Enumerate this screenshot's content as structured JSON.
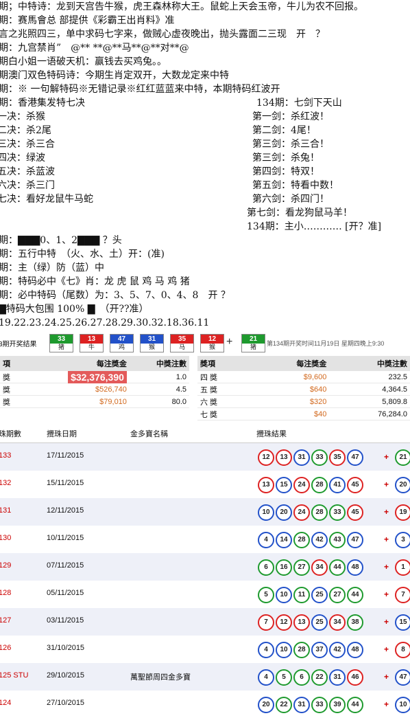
{
  "lines": [
    {
      "text": "期；中特诗：龙到天宫告牛猴，虎王森林称大王。鼠蛇上天会玉帝，牛儿为农不回报。"
    },
    {
      "text": "期：赛馬會总 部提供《彩霸王出肖料》准"
    },
    {
      "text": "言之兆照四三，单中求码七字来，做贼心虚夜晚出，抛头露面二三现　开　？"
    },
    {
      "text": "期：九宫禁肖”　@** **@**马**@**对**@"
    },
    {
      "text": "期白小姐一语破天机：赢钱去买鸡兔。。"
    },
    {
      "text": "期澳门双色特码诗：今期生肖定双开，大数龙定来中特"
    },
    {
      "text": "期：※ 一句解特码※无错记录※红红蓝蓝来中特，本期特码红波开"
    },
    {
      "text": "期：香港集发特七决"
    }
  ],
  "left_list": [
    "一决：杀猴",
    "二决：杀2尾",
    "三决：杀三合",
    "四决：绿波",
    "五决：杀蓝波",
    "六决：杀三门",
    "七决：看好龙鼠牛马蛇"
  ],
  "right_list": [
    "134期：七剑下天山",
    "第一剑：杀红波！",
    "第二剑：4尾！",
    "第三剑：杀三合！",
    "第三剑：杀兔！",
    "第四剑：特双！",
    "第五剑：特看中数！",
    "第六剑：杀四门！",
    "第七剑：看龙狗鼠马羊！",
    "134期：主小………… [开？准]"
  ],
  "lines2": [
    {
      "text": "期：▇▇▇0、1、2▇▇▇ ？头"
    },
    {
      "text": "期：五行中特　（火、水、土）开：(准)"
    },
    {
      "text": "期：主（绿）防（蓝）中"
    },
    {
      "text": "期：特码必中《七》肖：龙 虎 鼠 鸡 马 鸡 猪"
    },
    {
      "text": "期：必中特码（尾数）为：3、5、7、0、4、8　开 ？"
    },
    {
      "text": "▇特码大包围 100% ▇　（开??准）"
    },
    {
      "text": "19.22.23.24.25.26.27.28.29.30.32.18.36.11"
    }
  ],
  "strip": {
    "label": "3期开奖结果",
    "chips": [
      {
        "n": "33",
        "z": "猪",
        "color": "#1e9a2e"
      },
      {
        "n": "13",
        "z": "牛",
        "color": "#d22"
      },
      {
        "n": "47",
        "z": "鸡",
        "color": "#2251c9"
      },
      {
        "n": "31",
        "z": "猴",
        "color": "#2251c9"
      },
      {
        "n": "35",
        "z": "马",
        "color": "#d22"
      },
      {
        "n": "12",
        "z": "猴",
        "color": "#d22"
      }
    ],
    "plus": "+",
    "special": {
      "n": "21",
      "z": "猪",
      "color": "#1e9a2e"
    },
    "next": "第134期开奖时间11月19日 星期四晚上9:30"
  },
  "prize_left": {
    "headers": [
      "項",
      "每注獎金",
      "中獎注數"
    ],
    "rows": [
      {
        "name": "獎",
        "amount": "$32,376,390",
        "count": "1.0"
      },
      {
        "name": "獎",
        "amount": "$526,740",
        "count": "4.5"
      },
      {
        "name": "獎",
        "amount": "$79,010",
        "count": "80.0"
      }
    ]
  },
  "prize_right": {
    "headers": [
      "獎項",
      "每注獎金",
      "中獎注數"
    ],
    "rows": [
      {
        "name": "四 獎",
        "amount": "$9,600",
        "count": "232.5"
      },
      {
        "name": "五 獎",
        "amount": "$640",
        "count": "4,364.5"
      },
      {
        "name": "六 獎",
        "amount": "$320",
        "count": "5,809.8"
      },
      {
        "name": "七 獎",
        "amount": "$40",
        "count": "76,284.0"
      }
    ]
  },
  "history": {
    "headers": [
      "珠期數",
      "攪珠日期",
      "金多寶名稱",
      "攪珠結果"
    ],
    "rows": [
      {
        "id": "133",
        "date": "17/11/2015",
        "name": "",
        "balls": [
          [
            "12",
            "red"
          ],
          [
            "13",
            "red"
          ],
          [
            "31",
            "blue"
          ],
          [
            "33",
            "green"
          ],
          [
            "35",
            "red"
          ],
          [
            "47",
            "blue"
          ]
        ],
        "special": [
          "21",
          "green"
        ]
      },
      {
        "id": "132",
        "date": "15/11/2015",
        "name": "",
        "balls": [
          [
            "13",
            "red"
          ],
          [
            "15",
            "blue"
          ],
          [
            "24",
            "red"
          ],
          [
            "28",
            "green"
          ],
          [
            "41",
            "blue"
          ],
          [
            "45",
            "red"
          ]
        ],
        "special": [
          "20",
          "blue"
        ]
      },
      {
        "id": "131",
        "date": "12/11/2015",
        "name": "",
        "balls": [
          [
            "10",
            "blue"
          ],
          [
            "20",
            "blue"
          ],
          [
            "24",
            "red"
          ],
          [
            "28",
            "green"
          ],
          [
            "33",
            "green"
          ],
          [
            "45",
            "red"
          ]
        ],
        "special": [
          "19",
          "red"
        ]
      },
      {
        "id": "130",
        "date": "10/11/2015",
        "name": "",
        "balls": [
          [
            "4",
            "blue"
          ],
          [
            "14",
            "blue"
          ],
          [
            "28",
            "green"
          ],
          [
            "42",
            "blue"
          ],
          [
            "43",
            "green"
          ],
          [
            "47",
            "blue"
          ]
        ],
        "special": [
          "3",
          "blue"
        ]
      },
      {
        "id": "129",
        "date": "07/11/2015",
        "name": "",
        "balls": [
          [
            "6",
            "green"
          ],
          [
            "16",
            "green"
          ],
          [
            "27",
            "green"
          ],
          [
            "34",
            "red"
          ],
          [
            "44",
            "green"
          ],
          [
            "48",
            "blue"
          ]
        ],
        "special": [
          "1",
          "red"
        ]
      },
      {
        "id": "128",
        "date": "05/11/2015",
        "name": "",
        "balls": [
          [
            "5",
            "green"
          ],
          [
            "10",
            "blue"
          ],
          [
            "11",
            "green"
          ],
          [
            "25",
            "blue"
          ],
          [
            "27",
            "green"
          ],
          [
            "44",
            "green"
          ]
        ],
        "special": [
          "7",
          "red"
        ]
      },
      {
        "id": "127",
        "date": "03/11/2015",
        "name": "",
        "balls": [
          [
            "7",
            "red"
          ],
          [
            "12",
            "red"
          ],
          [
            "13",
            "red"
          ],
          [
            "25",
            "blue"
          ],
          [
            "34",
            "red"
          ],
          [
            "38",
            "green"
          ]
        ],
        "special": [
          "15",
          "blue"
        ]
      },
      {
        "id": "126",
        "date": "31/10/2015",
        "name": "",
        "balls": [
          [
            "4",
            "blue"
          ],
          [
            "10",
            "blue"
          ],
          [
            "28",
            "green"
          ],
          [
            "37",
            "blue"
          ],
          [
            "42",
            "blue"
          ],
          [
            "48",
            "blue"
          ]
        ],
        "special": [
          "8",
          "red"
        ]
      },
      {
        "id": "125 STU",
        "date": "29/10/2015",
        "name": "萬聖節周四金多寶",
        "balls": [
          [
            "4",
            "blue"
          ],
          [
            "5",
            "green"
          ],
          [
            "6",
            "green"
          ],
          [
            "22",
            "green"
          ],
          [
            "31",
            "blue"
          ],
          [
            "46",
            "red"
          ]
        ],
        "special": [
          "47",
          "blue"
        ]
      },
      {
        "id": "124",
        "date": "27/10/2015",
        "name": "",
        "balls": [
          [
            "20",
            "blue"
          ],
          [
            "22",
            "green"
          ],
          [
            "31",
            "blue"
          ],
          [
            "33",
            "green"
          ],
          [
            "39",
            "green"
          ],
          [
            "44",
            "green"
          ]
        ],
        "special": [
          "10",
          "blue"
        ]
      }
    ]
  }
}
